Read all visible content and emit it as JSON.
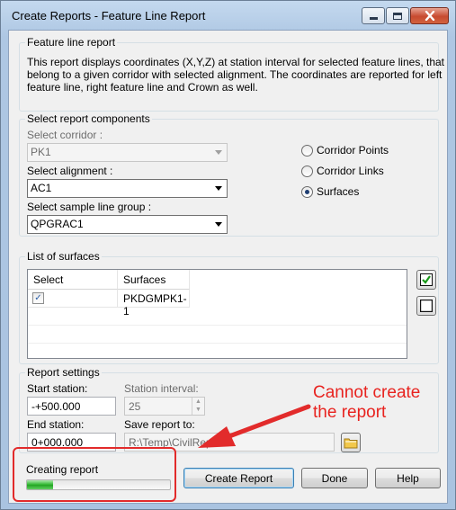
{
  "window": {
    "title": "Create Reports - Feature Line Report"
  },
  "description": {
    "group_label": "Feature line report",
    "text_line1": "This report displays coordinates (X,Y,Z) at station interval for selected feature lines, that",
    "text_line2": "belong to a given corridor with selected alignment. The coordinates are reported for left",
    "text_line3": "feature line, right feature line and Crown as well."
  },
  "components": {
    "group_label": "Select report components",
    "corridor_label": "Select corridor :",
    "corridor_value": "PK1",
    "alignment_label": "Select alignment :",
    "alignment_value": "AC1",
    "sample_line_label": "Select sample line group :",
    "sample_line_value": "QPGRAC1",
    "radio_corridor_points": "Corridor Points",
    "radio_corridor_links": "Corridor Links",
    "radio_surfaces": "Surfaces"
  },
  "surfaces": {
    "group_label": "List of surfaces",
    "columns": [
      "Select",
      "Surfaces"
    ],
    "rows": [
      {
        "checked": "✓",
        "name": "PKDGMPK1-1"
      }
    ]
  },
  "settings": {
    "group_label": "Report settings",
    "start_label": "Start station:",
    "start_value": "-+500.000",
    "interval_label": "Station interval:",
    "interval_value": "25",
    "end_label": "End station:",
    "end_value": "0+000.000",
    "save_label": "Save report to:",
    "save_value": "R:\\Temp\\CivilRep...ML"
  },
  "footer": {
    "progress_label": "Creating report",
    "progress_fraction": 0.18,
    "create_button": "Create Report",
    "done_button": "Done",
    "help_button": "Help"
  },
  "annotation": {
    "text": "Cannot create\nthe report",
    "color": "#e8231f"
  }
}
